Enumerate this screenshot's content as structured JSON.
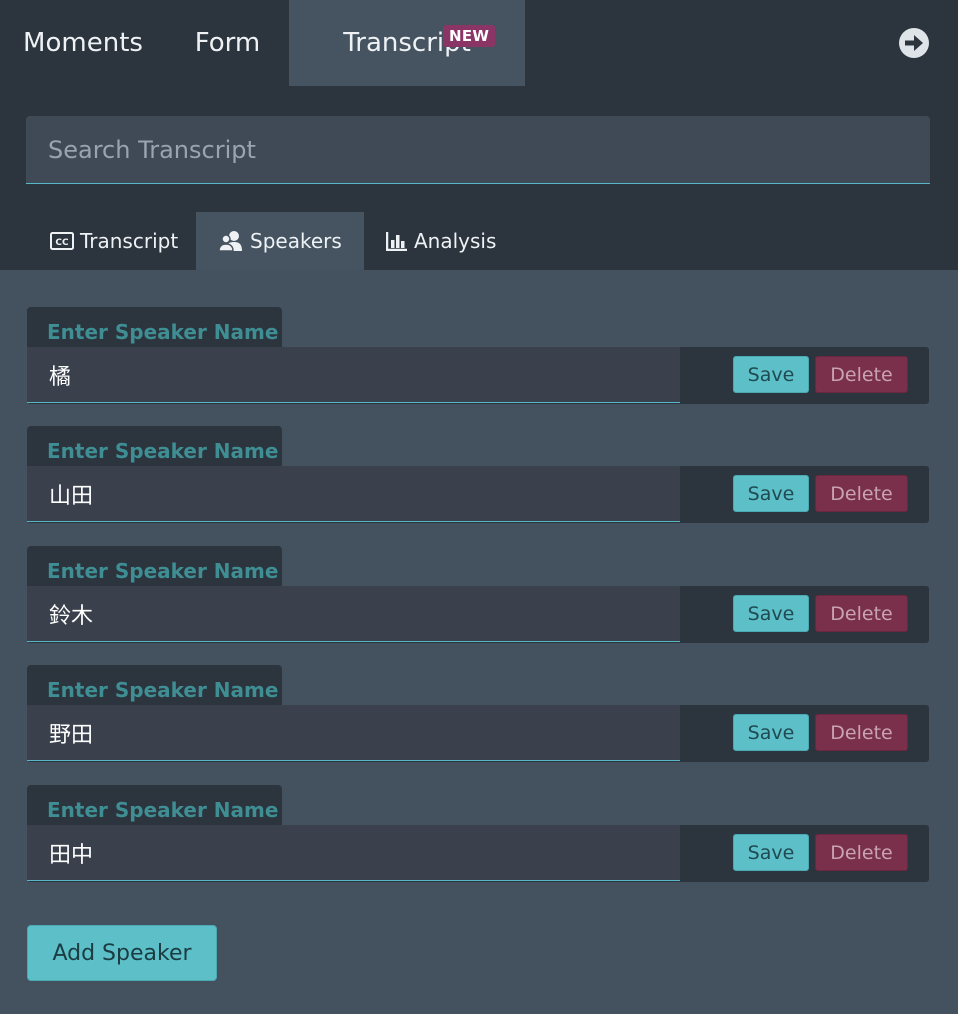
{
  "nav": {
    "tabs": [
      {
        "label": "Moments"
      },
      {
        "label": "Form"
      },
      {
        "label": "Transcript",
        "active": true
      }
    ],
    "badge": "NEW",
    "exit_icon": "arrow-right-circle-icon"
  },
  "search": {
    "placeholder": "Search Transcript",
    "value": ""
  },
  "subtabs": [
    {
      "label": "Transcript",
      "icon": "cc-icon"
    },
    {
      "label": "Speakers",
      "icon": "users-icon",
      "active": true
    },
    {
      "label": "Analysis",
      "icon": "bar-chart-icon"
    }
  ],
  "speakers": [
    {
      "label": "Enter Speaker Name",
      "value": "橘",
      "save": "Save",
      "delete": "Delete"
    },
    {
      "label": "Enter Speaker Name",
      "value": "山田",
      "save": "Save",
      "delete": "Delete"
    },
    {
      "label": "Enter Speaker Name",
      "value": "鈴木",
      "save": "Save",
      "delete": "Delete"
    },
    {
      "label": "Enter Speaker Name",
      "value": "野田",
      "save": "Save",
      "delete": "Delete"
    },
    {
      "label": "Enter Speaker Name",
      "value": "田中",
      "save": "Save",
      "delete": "Delete"
    }
  ],
  "add_speaker_label": "Add Speaker",
  "colors": {
    "accent": "#5dbfc7",
    "danger": "#7a2f4b",
    "badge": "#8b3567",
    "label": "#3e8e94"
  }
}
